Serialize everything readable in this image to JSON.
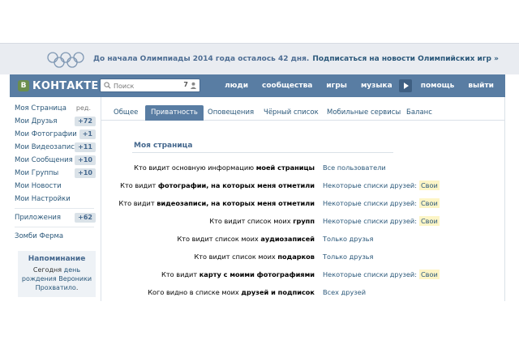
{
  "banner": {
    "text_prefix": "До начала Олимпиады 2014 года осталось 42 дня.",
    "link": "Подписаться на новости Олимпийских игр »"
  },
  "header": {
    "logo_badge": "В",
    "logo_text": "КОНТАКТЕ",
    "search_placeholder": "Поиск",
    "search_count": "7",
    "nav": [
      "люди",
      "сообщества",
      "игры",
      "музыка",
      "помощь",
      "выйти"
    ]
  },
  "sidebar": {
    "items": [
      {
        "label": "Моя Страница",
        "edit": "ред."
      },
      {
        "label": "Мои Друзья",
        "badge": "+72"
      },
      {
        "label": "Мои Фотографии",
        "badge": "+1"
      },
      {
        "label": "Мои Видеозаписи",
        "badge": "+11"
      },
      {
        "label": "Мои Сообщения",
        "badge": "+10"
      },
      {
        "label": "Мои Группы",
        "badge": "+10"
      },
      {
        "label": "Мои Новости"
      },
      {
        "label": "Мои Настройки"
      }
    ],
    "apps": {
      "label": "Приложения",
      "badge": "+62"
    },
    "zombie": "Зомби Ферма",
    "reminder": {
      "title": "Напоминание",
      "text_before": "Сегодня",
      "text_link1": "день рождения",
      "text_link2": "Вероники Прохватило",
      "text_after": "."
    }
  },
  "tabs": [
    "Общее",
    "Приватность",
    "Оповещения",
    "Чёрный список",
    "Мобильные сервисы",
    "Баланс"
  ],
  "active_tab": "Приватность",
  "section_title": "Моя страница",
  "rows": [
    {
      "pre": "Кто видит основную информацию ",
      "bold": "моей страницы",
      "post": "",
      "value": "Все пользователи",
      "extra": ""
    },
    {
      "pre": "Кто видит ",
      "bold": "фотографии, на которых меня отметили",
      "post": "",
      "value": "Некоторые списки друзей:",
      "extra": "Свои"
    },
    {
      "pre": "Кто видит ",
      "bold": "видеозаписи, на которых меня отметили",
      "post": "",
      "value": "Некоторые списки друзей:",
      "extra": "Свои"
    },
    {
      "pre": "Кто видит список моих ",
      "bold": "групп",
      "post": "",
      "value": "Некоторые списки друзей:",
      "extra": "Свои"
    },
    {
      "pre": "Кто видит список моих ",
      "bold": "аудиозаписей",
      "post": "",
      "value": "Только друзья",
      "extra": ""
    },
    {
      "pre": "Кто видит список моих ",
      "bold": "подарков",
      "post": "",
      "value": "Только друзья",
      "extra": ""
    },
    {
      "pre": "Кто видит ",
      "bold": "карту с моими фотографиями",
      "post": "",
      "value": "Некоторые списки друзей:",
      "extra": "Свои"
    },
    {
      "pre": "Кого видно в списке моих ",
      "bold": "друзей и подписок",
      "post": "",
      "value": "Всех друзей",
      "extra": ""
    }
  ],
  "colors": {
    "header": "#597da3",
    "link": "#2b587a",
    "badge_bg": "#dae2e8",
    "highlight": "#fdf5c6",
    "banner_bg": "#e9ecf1"
  },
  "icons": {
    "olympic": "olympic-rings-icon",
    "search": "search-icon",
    "user": "user-icon",
    "play": "play-icon"
  }
}
